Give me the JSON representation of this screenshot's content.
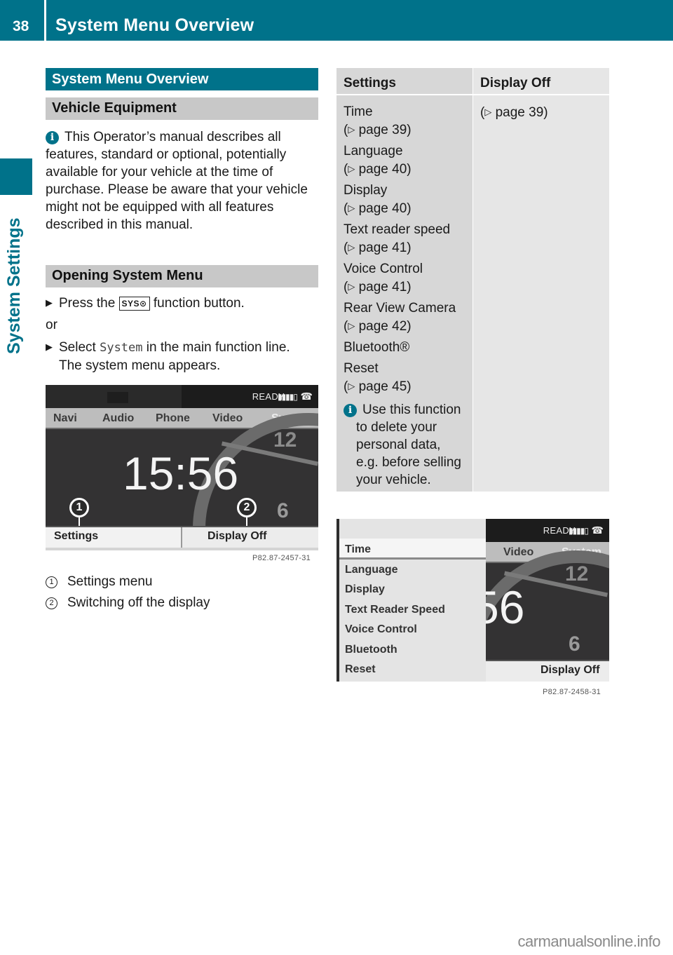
{
  "header": {
    "page_number": "38",
    "title": "System Menu Overview"
  },
  "sidebar": {
    "section_label": "System Settings"
  },
  "left_column": {
    "section_title": "System Menu Overview",
    "vehicle_equipment": {
      "heading": "Vehicle Equipment",
      "info_icon": "info-icon",
      "info_text": "This Operator’s manual describes all features, standard or optional, potentially available for your vehicle at the time of purchase. Please be aware that your vehicle might not be equipped with all features described in this manual."
    },
    "opening_system_menu": {
      "heading": "Opening System Menu",
      "step1_prefix": "Press the",
      "step1_key": "SYS⊙",
      "step1_suffix": "function button.",
      "or": "or",
      "step2_prefix": "Select",
      "step2_code": "System",
      "step2_suffix": "in the main function line.",
      "step2_result": "The system menu appears."
    },
    "figure1": {
      "status": {
        "ready": "READY",
        "signal": "▮▮▮▮▯",
        "phone_icon": "phone-hangup-icon"
      },
      "tabs": [
        "Navi",
        "Audio",
        "Phone",
        "Video",
        "System"
      ],
      "active_tab": "System",
      "clock": "15:56",
      "dial_12": "12",
      "dial_6": "6",
      "callout_1": "1",
      "callout_2": "2",
      "footer_left": "Settings",
      "footer_right": "Display Off",
      "code": "P82.87-2457-31"
    },
    "legend": [
      {
        "num": "1",
        "text": "Settings menu"
      },
      {
        "num": "2",
        "text": "Switching off the display"
      }
    ]
  },
  "table": {
    "headers": [
      "Settings",
      "Display Off"
    ],
    "settings_entries": [
      {
        "label": "Time",
        "ref": "page 39"
      },
      {
        "label": "Language",
        "ref": "page 40"
      },
      {
        "label": "Display",
        "ref": "page 40"
      },
      {
        "label": "Text reader speed",
        "ref": "page 41"
      },
      {
        "label": "Voice Control",
        "ref": "page 41"
      },
      {
        "label": "Rear View Camera",
        "ref": "page 42"
      },
      {
        "label": "Bluetooth®",
        "ref": ""
      },
      {
        "label": "Reset",
        "ref": "page 45"
      }
    ],
    "note_first": "Use this function",
    "note_rest": "to delete your personal data, e.g. before selling your vehicle.",
    "display_off_ref": "page 39"
  },
  "figure2": {
    "menu_items": [
      "Time",
      "Language",
      "Display",
      "Text Reader Speed",
      "Voice Control",
      "Bluetooth",
      "Reset"
    ],
    "selected_item": "Time",
    "status": {
      "ready": "READY",
      "signal": "▮▮▮▮▯",
      "phone_icon": "phone-hangup-icon"
    },
    "tabs": [
      "Video",
      "System"
    ],
    "active_tab": "System",
    "clock_partial": "56",
    "dial_12": "12",
    "dial_6": "6",
    "footer_right": "Display Off",
    "code": "P82.87-2458-31"
  },
  "watermark": "carmanualsonline.info",
  "colors": {
    "brand_teal": "#00728a",
    "heading_gray": "#c8c8c8",
    "table_col1": "#d7d7d7",
    "table_col2": "#e6e6e6"
  }
}
